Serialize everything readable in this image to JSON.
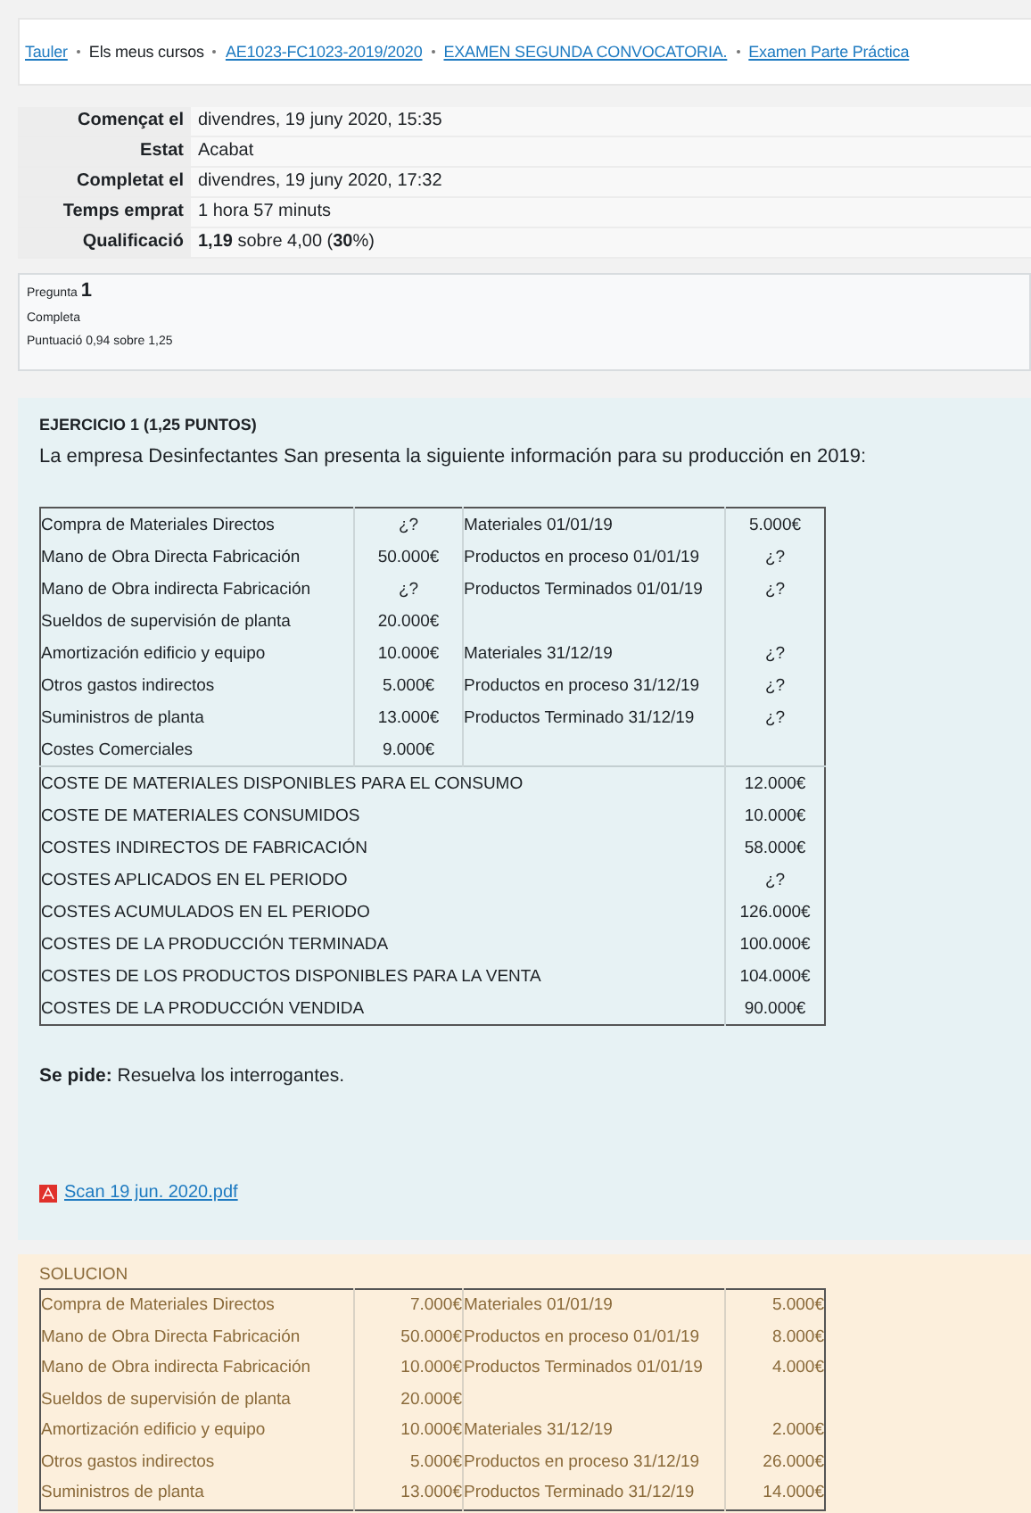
{
  "breadcrumb": [
    {
      "text": "Tauler",
      "link": true
    },
    {
      "text": "Els meus cursos",
      "link": false
    },
    {
      "text": "AE1023-FC1023-2019/2020",
      "link": true
    },
    {
      "text": "EXAMEN SEGUNDA CONVOCATORIA.",
      "link": true
    },
    {
      "text": "Examen Parte Práctica",
      "link": true
    }
  ],
  "summary": [
    {
      "label": "Començat el",
      "value": "divendres, 19 juny 2020, 15:35"
    },
    {
      "label": "Estat",
      "value": "Acabat"
    },
    {
      "label": "Completat el",
      "value": "divendres, 19 juny 2020, 17:32"
    },
    {
      "label": "Temps emprat",
      "value": "1 hora 57 minuts"
    },
    {
      "label": "Qualificació",
      "value": "**1,19** sobre 4,00 (**30**%)"
    }
  ],
  "question_info": {
    "number_label": "Pregunta",
    "number": "1",
    "state": "Completa",
    "mark": "Puntuació 0,94 sobre 1,25"
  },
  "question": {
    "title": "EJERCICIO 1 (1,25 PUNTOS)",
    "intro": "La empresa Desinfectantes San presenta la siguiente información para su producción en 2019:",
    "rows": [
      {
        "item": "Compra de Materiales Directos",
        "amount": "¿?",
        "item_2": "Materiales 01/01/19",
        "amount_2": "5.000€"
      },
      {
        "item": "Mano de Obra Directa Fabricación",
        "amount": "50.000€",
        "item_2": "Productos en proceso 01/01/19",
        "amount_2": "¿?"
      },
      {
        "item": "Mano de Obra indirecta Fabricación",
        "amount": "¿?",
        "item_2": "Productos Terminados 01/01/19",
        "amount_2": "¿?"
      },
      {
        "item": "Sueldos de supervisión de planta",
        "amount": "20.000€"
      },
      {
        "item": "Amortización edificio y equipo",
        "amount": "10.000€",
        "item_2": "Materiales 31/12/19",
        "amount_2": "¿?"
      },
      {
        "item": "Otros gastos indirectos",
        "amount": "5.000€",
        "item_2": "Productos en proceso 31/12/19",
        "amount_2": "¿?"
      },
      {
        "item": "Suministros de planta",
        "amount": "13.000€",
        "item_2": "Productos Terminado 31/12/19",
        "amount_2": "¿?"
      },
      {
        "item": "Costes Comerciales",
        "amount": "9.000€"
      }
    ],
    "totals": [
      {
        "label": "COSTE DE MATERIALES DISPONIBLES PARA EL CONSUMO",
        "value": "12.000€"
      },
      {
        "label": "COSTE DE MATERIALES CONSUMIDOS",
        "value": "10.000€"
      },
      {
        "label": "COSTES INDIRECTOS DE FABRICACIÓN",
        "value": "58.000€"
      },
      {
        "label": "COSTES APLICADOS EN EL PERIODO",
        "value": "¿?"
      },
      {
        "label": "COSTES ACUMULADOS EN EL PERIODO",
        "value": "126.000€"
      },
      {
        "label": "COSTES DE LA PRODUCCIÓN TERMINADA",
        "value": "100.000€"
      },
      {
        "label": "COSTES DE LOS PRODUCTOS DISPONIBLES PARA LA VENTA",
        "value": "104.000€"
      },
      {
        "label": "COSTES DE LA PRODUCCIÓN VENDIDA",
        "value": "90.000€"
      }
    ],
    "request": "**Se pide:** Resuelva los interrogantes.",
    "attachment": "Scan 19 jun. 2020.pdf"
  },
  "solution": {
    "title": "SOLUCION",
    "rows": [
      {
        "item": "Compra de Materiales Directos",
        "amount": "7.000€",
        "item_2": "Materiales 01/01/19",
        "amount_2": "5.000€"
      },
      {
        "item": "Mano de Obra Directa Fabricación",
        "amount": "50.000€",
        "item_2": "Productos en proceso 01/01/19",
        "amount_2": "8.000€"
      },
      {
        "item": "Mano de Obra indirecta Fabricación",
        "amount": "10.000€",
        "item_2": "Productos Terminados 01/01/19",
        "amount_2": "4.000€"
      },
      {
        "item": "Sueldos de supervisión de planta",
        "amount": "20.000€"
      },
      {
        "item": "Amortización edificio y equipo",
        "amount": "10.000€",
        "item_2": "Materiales 31/12/19",
        "amount_2": "2.000€"
      },
      {
        "item": "Otros gastos indirectos",
        "amount": "5.000€",
        "item_2": "Productos en proceso 31/12/19",
        "amount_2": "26.000€"
      },
      {
        "item": "Suministros de planta",
        "amount": "13.000€",
        "item_2": "Productos Terminado 31/12/19",
        "amount_2": "14.000€"
      }
    ]
  }
}
